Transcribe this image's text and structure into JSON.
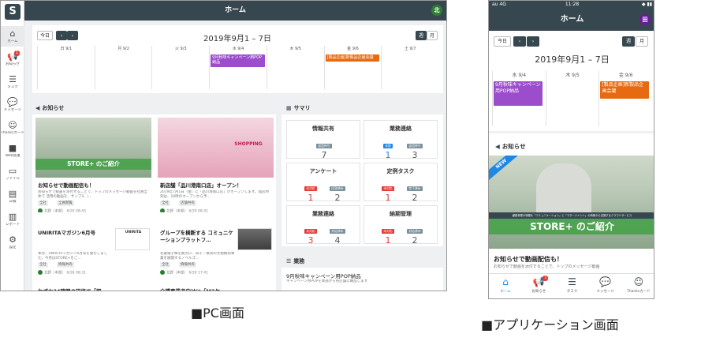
{
  "pc": {
    "header_title": "ホーム",
    "avatar": "北",
    "sidebar": [
      {
        "label": "ホーム",
        "icon": "home-icon",
        "glyph": "⌂"
      },
      {
        "label": "お知らせ",
        "icon": "megaphone-icon",
        "glyph": "📢",
        "badge": "1"
      },
      {
        "label": "タスク",
        "icon": "task-list-icon",
        "glyph": "☰"
      },
      {
        "label": "メッセージ",
        "icon": "message-icon",
        "glyph": "💬"
      },
      {
        "label": "Thanksカード",
        "icon": "smile-icon",
        "glyph": "☺"
      },
      {
        "label": "Web会議",
        "icon": "video-icon",
        "glyph": "■"
      },
      {
        "label": "ファイル",
        "icon": "folder-icon",
        "glyph": "▭"
      },
      {
        "label": "日報",
        "icon": "document-icon",
        "glyph": "▤"
      },
      {
        "label": "レポート",
        "icon": "report-icon",
        "glyph": "▥"
      },
      {
        "label": "設定",
        "icon": "gear-icon",
        "glyph": "⚙"
      }
    ],
    "calendar": {
      "today_label": "今日",
      "prev": "‹",
      "next": "›",
      "title": "2019年9月1 – 7日",
      "week_label": "週",
      "month_label": "月",
      "days": [
        "日 9/1",
        "月 9/2",
        "火 9/3",
        "水 9/4",
        "木 9/5",
        "金 9/6",
        "土 9/7"
      ],
      "events": [
        {
          "day": 3,
          "text": "9月秋味キャンペーン用POP納品",
          "color": "purple"
        },
        {
          "day": 5,
          "text": "[製品企画]新製品企画会議",
          "color": "orange"
        }
      ]
    },
    "notice": {
      "title": "お知らせ",
      "items": [
        {
          "thumb_caption": "STORE+ のご紹介",
          "title": "お知らせで動画配信も！",
          "body": "お知らせで動画を添付することで、トップのメッセージ動画を社員全体で 活用の動画を、サンプル（…",
          "tags": [
            "全社",
            "全員閲覧"
          ],
          "author": "北野（本部）",
          "date": "6/29 08:45"
        },
        {
          "thumb_caption": "SHOPPING",
          "title": "新店舗「品川港南口店」オープン！",
          "body": "2019年7月1日（金）に「品川港南口店」がオープンします。開店時刻は、10時のオープンから予…",
          "tags": [
            "全社",
            "店舗共有"
          ],
          "author": "北野（本部）",
          "date": "6/29 08:41"
        },
        {
          "thumb_caption": "UNIRITA",
          "title": "UNIRITAマガジン6月号",
          "body": "本月、UNIRITAマガジン6月号を発行しました。今月はSTORE+をご…",
          "tags": [
            "全社",
            "情報共有"
          ],
          "author": "北野（本部）",
          "date": "6/28 08:31"
        },
        {
          "thumb_caption": "",
          "title": "グループを横断する コミュニケーションプラットフ…",
          "body": "北電電子株を拠点に、四十・携帯の大規模商事業を展開するノベルズ…",
          "tags": [
            "全社",
            "情報共有"
          ],
          "author": "北野（本部）",
          "date": "6/20 17:41"
        },
        {
          "thumb_caption": "",
          "title": "わずか24時間の研修で「即…",
          "body": "",
          "tags": [],
          "author": "",
          "date": ""
        },
        {
          "thumb_caption": "",
          "title": "介護事業者向けに「M3ケ…",
          "body": "",
          "tags": [],
          "author": "",
          "date": ""
        }
      ]
    },
    "summary": {
      "title": "サマリ",
      "cards": [
        {
          "title": "情報共有",
          "cols": [
            {
              "label": "返信待ち",
              "value": "7",
              "color": "grey"
            }
          ]
        },
        {
          "title": "業務連絡",
          "cols": [
            {
              "label": "未読",
              "value": "1",
              "color": "blue"
            },
            {
              "label": "返信待ち",
              "value": "3",
              "color": "grey"
            }
          ]
        },
        {
          "title": "アンケート",
          "cols": [
            {
              "label": "未対応",
              "value": "1",
              "color": "red"
            },
            {
              "label": "回答済み",
              "value": "2",
              "color": "grey"
            }
          ]
        },
        {
          "title": "定例タスク",
          "cols": [
            {
              "label": "未対応",
              "value": "1",
              "color": "red"
            },
            {
              "label": "完了済み",
              "value": "2",
              "color": "grey"
            }
          ]
        },
        {
          "title": "業務連絡",
          "cols": [
            {
              "label": "未対応",
              "value": "3",
              "color": "red"
            },
            {
              "label": "対応済み",
              "value": "4",
              "color": "grey"
            }
          ]
        },
        {
          "title": "納期管理",
          "cols": [
            {
              "label": "未対応",
              "value": "1",
              "color": "red"
            },
            {
              "label": "対応済み",
              "value": "2",
              "color": "grey"
            }
          ]
        }
      ]
    },
    "tasks": {
      "title": "業務",
      "item_title": "9月秋味キャンペーン用POP納品",
      "item_body": "キャンペーン用POPを本部から各店舗に納品します"
    }
  },
  "app": {
    "status_carrier": "au 4G",
    "status_time": "11:28",
    "status_battery": "◆ ▮▮",
    "header_title": "ホーム",
    "avatar": "田",
    "calendar": {
      "today_label": "今日",
      "prev": "‹",
      "next": "›",
      "title": "2019年9月1 – 7日",
      "week_label": "週",
      "month_label": "月",
      "days": [
        "水 9/4",
        "木 9/5",
        "金 9/6"
      ],
      "events": [
        {
          "day": 0,
          "text": "9月秋味キャンペーン用POP納品",
          "color": "purple"
        },
        {
          "day": 2,
          "text": "[製品企画]新製品企画会議",
          "color": "orange"
        }
      ]
    },
    "notice_title": "お知らせ",
    "banner_strip": "顧客事業の特徴を「コミュニケーション」と「マネージメント」の両側から支援するクラウドサービス",
    "banner_caption": "STORE+ のご紹介",
    "new_badge": "NEW",
    "notice_item_title": "お知らせで動画配信も！",
    "notice_item_body": "お知らせで動画を添付することで、トップのメッセージ動画",
    "tabs": [
      {
        "label": "ホーム",
        "icon": "home-icon",
        "glyph": "⌂",
        "active": true
      },
      {
        "label": "お知らせ",
        "icon": "megaphone-icon",
        "glyph": "📢",
        "badge": "1"
      },
      {
        "label": "タスク",
        "icon": "task-list-icon",
        "glyph": "☰"
      },
      {
        "label": "メッセージ",
        "icon": "message-icon",
        "glyph": "💬"
      },
      {
        "label": "Thanksカード",
        "icon": "smile-icon",
        "glyph": "☺"
      }
    ]
  },
  "captions": {
    "pc": "■PC画面",
    "app": "■アプリケーション画面"
  },
  "colors": {
    "header": "#37474f",
    "event_purple": "#9c4dcc",
    "event_orange": "#e56a11",
    "accent_blue": "#1e88e5",
    "alert_red": "#e53935"
  }
}
